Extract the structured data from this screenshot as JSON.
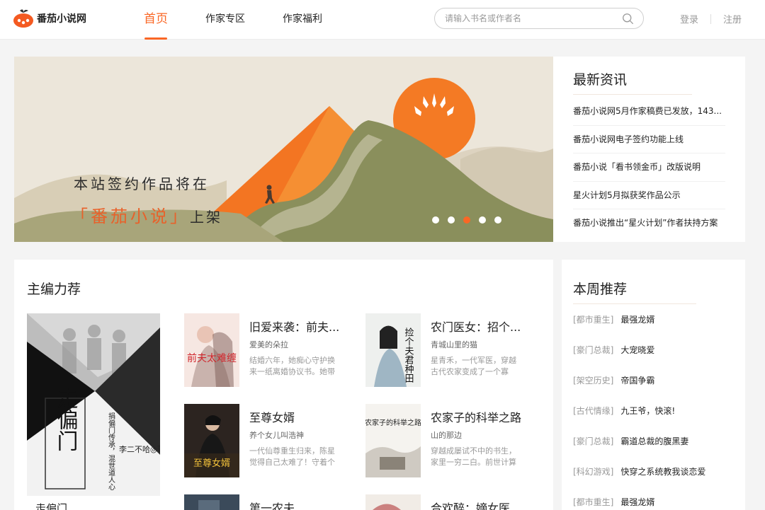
{
  "header": {
    "logo_text": "番茄小说网",
    "nav": [
      {
        "label": "首页",
        "active": true
      },
      {
        "label": "作家专区",
        "active": false
      },
      {
        "label": "作家福利",
        "active": false
      }
    ],
    "search_placeholder": "请输入书名或作者名",
    "login": "登录",
    "register": "注册"
  },
  "banner": {
    "line1": "本站签约作品将在",
    "line2_highlight": "「番茄小说」",
    "line2_rest": "上架",
    "slide_count": 5,
    "active_slide": 3
  },
  "news": {
    "title": "最新资讯",
    "items": [
      "番茄小说网5月作家稿费已发放，143...",
      "番茄小说网电子签约功能上线",
      "番茄小说「看书领金币」改版说明",
      "星火计划5月拟获奖作品公示",
      "番茄小说推出“星火计划”作者扶持方案"
    ]
  },
  "editor": {
    "title": "主编力荐",
    "feature": {
      "title": "走偏门",
      "cover_title": "走偏门",
      "cover_author": "李二不哈◎著",
      "cover_tagline": "捐偏门传承，混世道人心"
    },
    "books": [
      {
        "title": "旧爱来袭：前夫...",
        "author": "爱美的朵拉",
        "desc": "结婚六年，她痴心守护换来一纸离婚协议书。她带娃...",
        "cover_text": "前夫太难缠"
      },
      {
        "title": "农门医女：招个...",
        "author": "青城山里的猫",
        "desc": "星青禾，一代军医，穿越古代农家变成了一个寡妇，...",
        "cover_text": "捡个夫君种田"
      },
      {
        "title": "至尊女婿",
        "author": "养个女儿叫浩神",
        "desc": "一代仙尊重生归来，陈星觉得自己太难了！守着个冷...",
        "cover_text": "至尊女婿"
      },
      {
        "title": "农家子的科举之路",
        "author": "山的那边",
        "desc": "穿越成屡试不中的书生，家里一穷二白。前世计算机...",
        "cover_text": "农家子的科举之路"
      },
      {
        "title": "第一农夫",
        "author": "",
        "desc": "",
        "cover_text": ""
      },
      {
        "title": "合欢醉：嫡女医...",
        "author": "",
        "desc": "",
        "cover_text": ""
      }
    ]
  },
  "weekly": {
    "title": "本周推荐",
    "items": [
      {
        "cat": "[都市重生]",
        "name": "最强龙婿"
      },
      {
        "cat": "[豪门总裁]",
        "name": "大宠晓爱"
      },
      {
        "cat": "[架空历史]",
        "name": "帝国争霸"
      },
      {
        "cat": "[古代情缘]",
        "name": "九王爷，快滚!"
      },
      {
        "cat": "[豪门总裁]",
        "name": "霸道总裁的腹黑妻"
      },
      {
        "cat": "[科幻游戏]",
        "name": "快穿之系统教我谈恋爱"
      },
      {
        "cat": "[都市重生]",
        "name": "最强龙婿"
      }
    ]
  },
  "colors": {
    "accent": "#fa6725",
    "background": "#f4f4f4",
    "banner_sun": "#f47a24",
    "banner_hill": "#8a8f5c"
  },
  "icons": {
    "logo": "tomato-logo-icon",
    "search": "search-icon"
  }
}
